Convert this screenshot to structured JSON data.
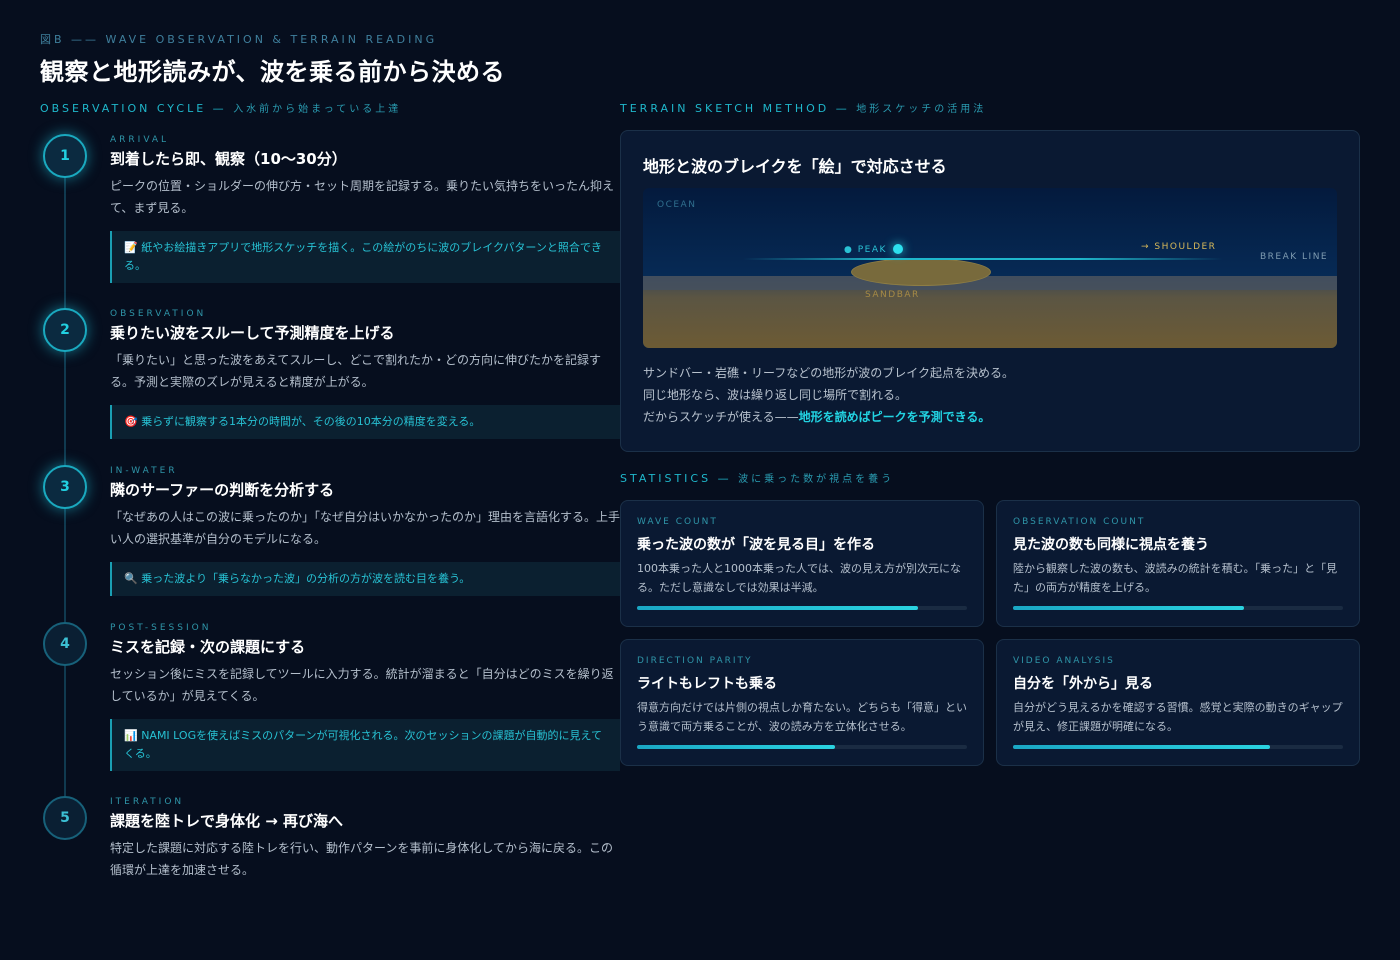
{
  "header": {
    "kicker": "図B —— WAVE OBSERVATION & TERRAIN READING",
    "title": "観察と地形読みが、波を乗る前から決める"
  },
  "cycle": {
    "label": "OBSERVATION CYCLE —",
    "sublabel": "入水前から始まっている上達",
    "steps": [
      {
        "num": "1",
        "tag": "ARRIVAL",
        "title": "到着したら即、観察（10〜30分）",
        "desc": "ピークの位置・ショルダーの伸び方・セット周期を記録する。乗りたい気持ちをいったん抑えて、まず見る。",
        "note": "📝 紙やお絵描きアプリで地形スケッチを描く。この絵がのちに波のブレイクパターンと照合できる。"
      },
      {
        "num": "2",
        "tag": "OBSERVATION",
        "title": "乗りたい波をスルーして予測精度を上げる",
        "desc": "「乗りたい」と思った波をあえてスルーし、どこで割れたか・どの方向に伸びたかを記録する。予測と実際のズレが見えると精度が上がる。",
        "note": "🎯 乗らずに観察する1本分の時間が、その後の10本分の精度を変える。"
      },
      {
        "num": "3",
        "tag": "IN-WATER",
        "title": "隣のサーファーの判断を分析する",
        "desc": "「なぜあの人はこの波に乗ったのか」「なぜ自分はいかなかったのか」理由を言語化する。上手い人の選択基準が自分のモデルになる。",
        "note": "🔍 乗った波より「乗らなかった波」の分析の方が波を読む目を養う。"
      },
      {
        "num": "4",
        "tag": "POST-SESSION",
        "title": "ミスを記録・次の課題にする",
        "desc": "セッション後にミスを記録してツールに入力する。統計が溜まると「自分はどのミスを繰り返しているか」が見えてくる。",
        "note": "📊 NAMI LOGを使えばミスのパターンが可視化される。次のセッションの課題が自動的に見えてくる。"
      },
      {
        "num": "5",
        "tag": "ITERATION",
        "title": "課題を陸トレで身体化 → 再び海へ",
        "desc": "特定した課題に対応する陸トレを行い、動作パターンを事前に身体化してから海に戻る。この循環が上達を加速させる。",
        "note": ""
      }
    ]
  },
  "terrain": {
    "label": "TERRAIN SKETCH METHOD —",
    "sublabel": "地形スケッチの活用法",
    "title": "地形と波のブレイクを「絵」で対応させる",
    "sketch_labels": {
      "ocean": "OCEAN",
      "peak": "● PEAK",
      "shoulder": "→ SHOULDER",
      "break_line": "BREAK LINE",
      "sandbar": "SANDBAR"
    },
    "desc_line1": "サンドバー・岩礁・リーフなどの地形が波のブレイク起点を決める。",
    "desc_line2": "同じ地形なら、波は繰り返し同じ場所で割れる。",
    "desc_line3_prefix": "だからスケッチが使える——",
    "desc_line3_highlight": "地形を読めばピークを予測できる。"
  },
  "stats": {
    "label": "STATISTICS —",
    "sublabel": "波に乗った数が視点を養う",
    "cards": [
      {
        "tag": "WAVE COUNT",
        "title": "乗った波の数が「波を見る目」を作る",
        "desc": "100本乗った人と1000本乗った人では、波の見え方が別次元になる。ただし意識なしでは効果は半減。",
        "progress": 0.85
      },
      {
        "tag": "OBSERVATION COUNT",
        "title": "見た波の数も同様に視点を養う",
        "desc": "陸から観察した波の数も、波読みの統計を積む。「乗った」と「見た」の両方が精度を上げる。",
        "progress": 0.7
      },
      {
        "tag": "DIRECTION PARITY",
        "title": "ライトもレフトも乗る",
        "desc": "得意方向だけでは片側の視点しか育たない。どちらも「得意」という意識で両方乗ることが、波の読み方を立体化させる。",
        "progress": 0.6
      },
      {
        "tag": "VIDEO ANALYSIS",
        "title": "自分を「外から」見る",
        "desc": "自分がどう見えるかを確認する習慣。感覚と実際の動きのギャップが見え、修正課題が明確になる。",
        "progress": 0.78
      }
    ]
  },
  "colors": {
    "background": "#060e1e",
    "accent": "#1fb7cb",
    "card": "#0a1932",
    "sand": "#786a3c"
  }
}
